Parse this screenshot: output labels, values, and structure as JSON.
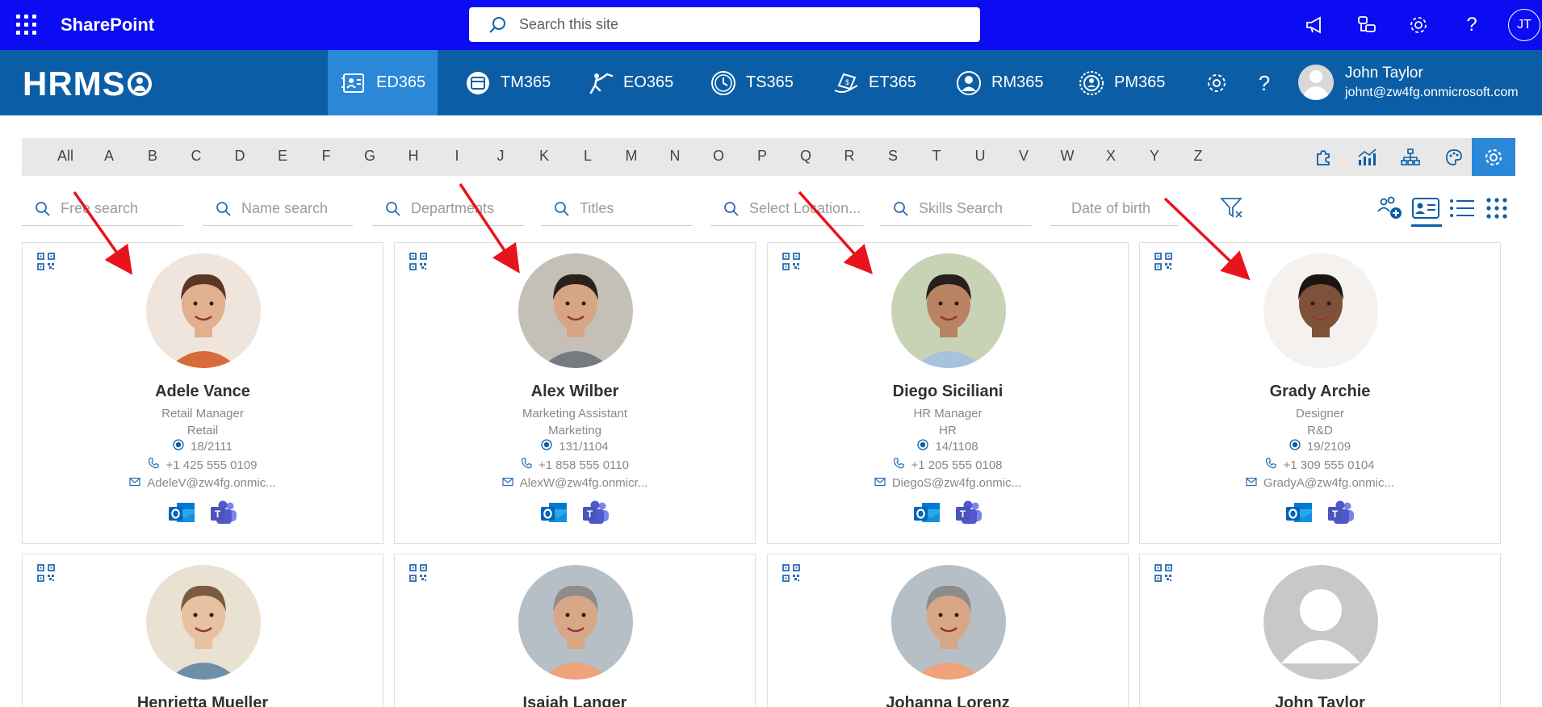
{
  "suite": {
    "title": "SharePoint",
    "search_placeholder": "Search this site",
    "user_initials": "JT"
  },
  "app": {
    "brand": "HRMS",
    "nav": [
      {
        "label": "ED365",
        "active": true
      },
      {
        "label": "TM365",
        "active": false
      },
      {
        "label": "EO365",
        "active": false
      },
      {
        "label": "TS365",
        "active": false
      },
      {
        "label": "ET365",
        "active": false
      },
      {
        "label": "RM365",
        "active": false
      },
      {
        "label": "PM365",
        "active": false
      }
    ],
    "user": {
      "name": "John Taylor",
      "email": "johnt@zw4fg.onmicrosoft.com"
    }
  },
  "alphabet": [
    "All",
    "A",
    "B",
    "C",
    "D",
    "E",
    "F",
    "G",
    "H",
    "I",
    "J",
    "K",
    "L",
    "M",
    "N",
    "O",
    "P",
    "Q",
    "R",
    "S",
    "T",
    "U",
    "V",
    "W",
    "X",
    "Y",
    "Z"
  ],
  "filters": {
    "free": "Free search",
    "name": "Name search",
    "departments": "Departments",
    "titles": "Titles",
    "location": "Select Location...",
    "skills": "Skills Search",
    "dob": "Date of birth"
  },
  "employees": [
    {
      "name": "Adele Vance",
      "title": "Retail Manager",
      "department": "Retail",
      "location": "18/2111",
      "phone": "+1 425 555 0109",
      "email": "AdeleV@zw4fg.onmic..."
    },
    {
      "name": "Alex Wilber",
      "title": "Marketing Assistant",
      "department": "Marketing",
      "location": "131/1104",
      "phone": "+1 858 555 0110",
      "email": "AlexW@zw4fg.onmicr..."
    },
    {
      "name": "Diego Siciliani",
      "title": "HR Manager",
      "department": "HR",
      "location": "14/1108",
      "phone": "+1 205 555 0108",
      "email": "DiegoS@zw4fg.onmic..."
    },
    {
      "name": "Grady Archie",
      "title": "Designer",
      "department": "R&D",
      "location": "19/2109",
      "phone": "+1 309 555 0104",
      "email": "GradyA@zw4fg.onmic..."
    },
    {
      "name": "Henrietta Mueller"
    },
    {
      "name": "Isaiah Langer"
    },
    {
      "name": "Johanna Lorenz"
    },
    {
      "name": "John Taylor"
    }
  ],
  "colors": {
    "suite_bar": "#0c0cf2",
    "app_bar": "#0b5ea6",
    "active_nav": "#2b88d8",
    "annotation_arrow": "#e8141c"
  }
}
